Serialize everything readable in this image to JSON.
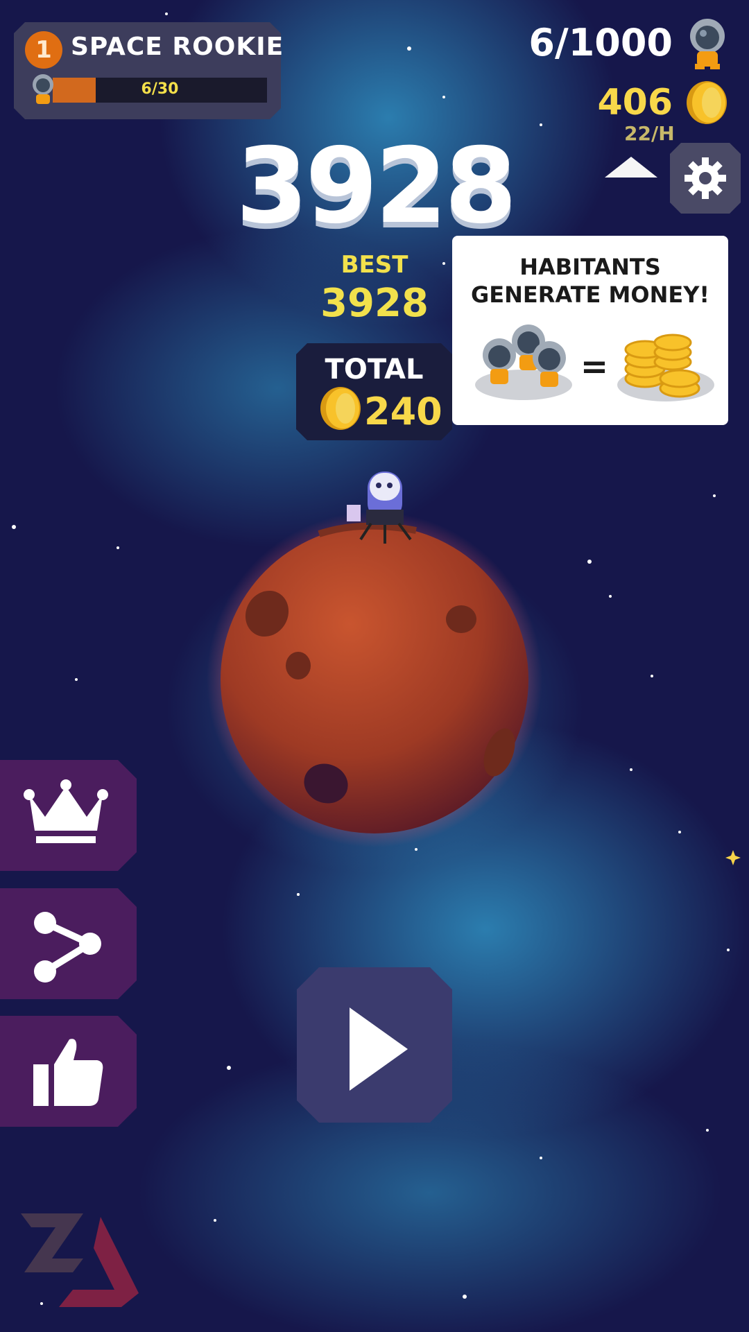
{
  "player": {
    "rank_number": "1",
    "rank_title": "SPACE ROOKIE",
    "rank_progress_text": "6/30",
    "rank_progress": 0.2
  },
  "resources": {
    "habitants": "6/1000",
    "coins": "406",
    "rate": "22/H"
  },
  "score": {
    "current": "3928",
    "best_label": "BEST",
    "best_value": "3928"
  },
  "total": {
    "label": "TOTAL",
    "value": "240"
  },
  "tip": {
    "line1": "HABITANTS",
    "line2": "GENERATE MONEY!",
    "equals": "="
  },
  "icons": {
    "leaderboard": "crown-icon",
    "share": "share-icon",
    "like": "thumbs-up-icon",
    "play": "play-icon",
    "settings": "gear-icon",
    "coin": "coin-icon",
    "habitant": "astronaut-icon"
  },
  "colors": {
    "accent_gold": "#f8d84a",
    "panel": "#3d3d5c",
    "side_button": "#4b1d5e",
    "play_button": "#3b3b6e",
    "planet": "#b8442a",
    "rank_badge": "#e06e12"
  }
}
